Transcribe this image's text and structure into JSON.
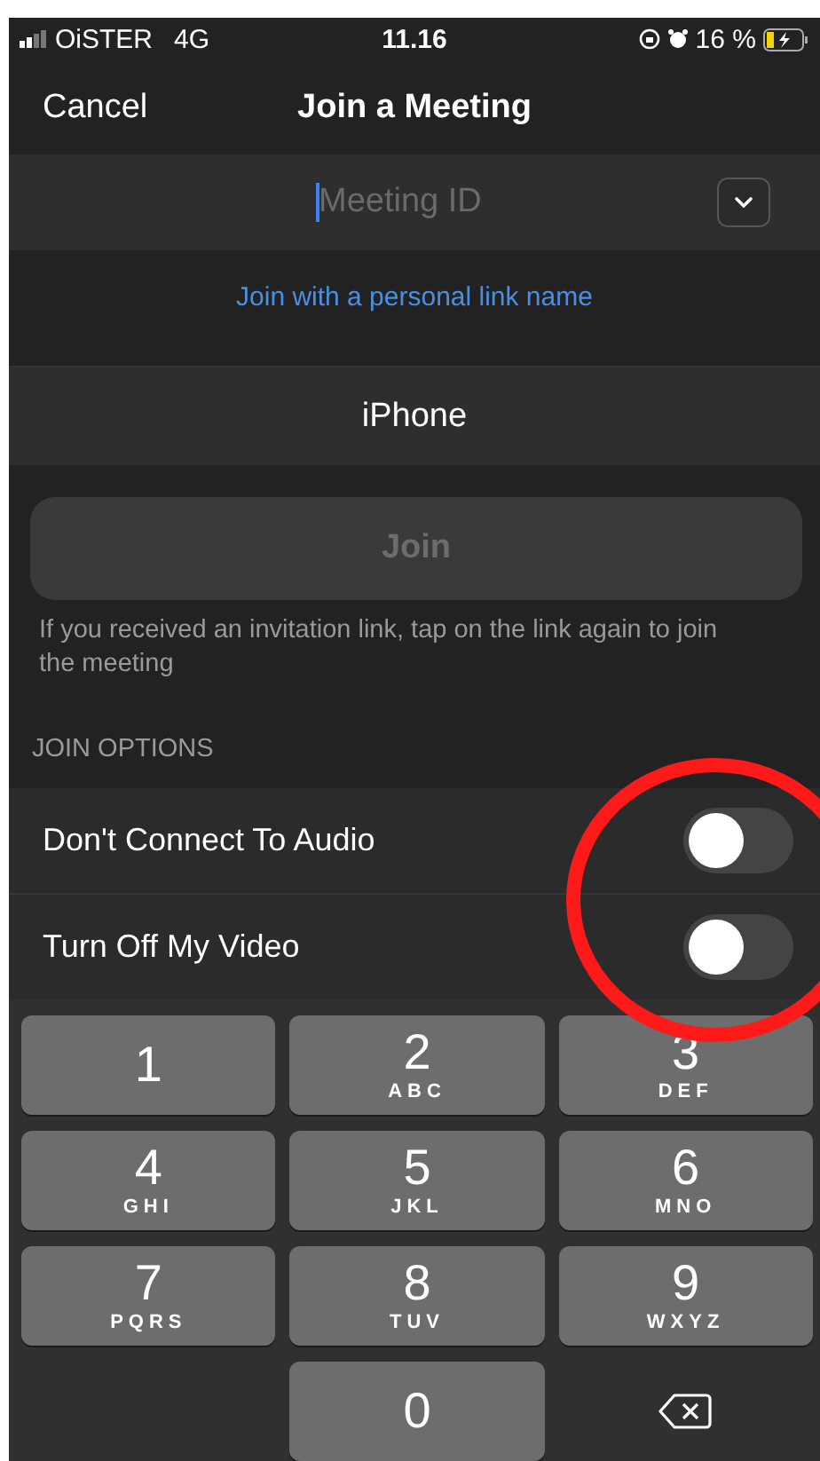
{
  "status_bar": {
    "carrier": "OiSTER",
    "network": "4G",
    "time": "11.16",
    "battery": "16 %"
  },
  "nav": {
    "cancel": "Cancel",
    "title": "Join a Meeting"
  },
  "meeting_id": {
    "placeholder": "Meeting ID"
  },
  "personal_link": "Join with a personal link name",
  "name_field": {
    "value": "iPhone"
  },
  "join_button": {
    "label": "Join",
    "disabled": true
  },
  "hint": "If you received an invitation link, tap on the link again to join the meeting",
  "options_header": "JOIN OPTIONS",
  "options": [
    {
      "label": "Don't Connect To Audio",
      "on": false
    },
    {
      "label": "Turn Off My Video",
      "on": false
    }
  ],
  "keypad": [
    {
      "kind": "digit",
      "digit": "1"
    },
    {
      "kind": "digit",
      "digit": "2",
      "letters": "ABC"
    },
    {
      "kind": "digit",
      "digit": "3",
      "letters": "DEF"
    },
    {
      "kind": "digit",
      "digit": "4",
      "letters": "GHI"
    },
    {
      "kind": "digit",
      "digit": "5",
      "letters": "JKL"
    },
    {
      "kind": "digit",
      "digit": "6",
      "letters": "MNO"
    },
    {
      "kind": "digit",
      "digit": "7",
      "letters": "PQRS"
    },
    {
      "kind": "digit",
      "digit": "8",
      "letters": "TUV"
    },
    {
      "kind": "digit",
      "digit": "9",
      "letters": "WXYZ"
    },
    {
      "kind": "blank"
    },
    {
      "kind": "digit",
      "digit": "0"
    },
    {
      "kind": "delete"
    }
  ]
}
